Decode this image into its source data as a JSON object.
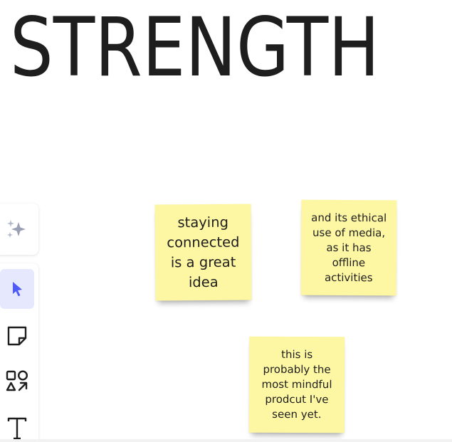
{
  "board": {
    "heading": "STRENGTH"
  },
  "toolbar": {
    "ai_icon": "sparkle-icon",
    "tools": [
      {
        "name": "select",
        "icon": "cursor-arrow-icon",
        "active": true
      },
      {
        "name": "sticky-note",
        "icon": "sticky-note-icon",
        "active": false
      },
      {
        "name": "shapes",
        "icon": "shapes-icon",
        "active": false
      },
      {
        "name": "text",
        "icon": "text-icon",
        "active": false
      }
    ],
    "accent_color": "#4f5bf7",
    "active_bg": "#e6e8fd"
  },
  "stickies": [
    {
      "text": "staying connected is a great idea",
      "color": "#fdf6a3"
    },
    {
      "text": "and its ethical use of media, as it has offline activities",
      "color": "#fdf6a3"
    },
    {
      "text": "this is probably the most mindful prodcut I've seen yet.",
      "color": "#fdf6a3"
    }
  ]
}
